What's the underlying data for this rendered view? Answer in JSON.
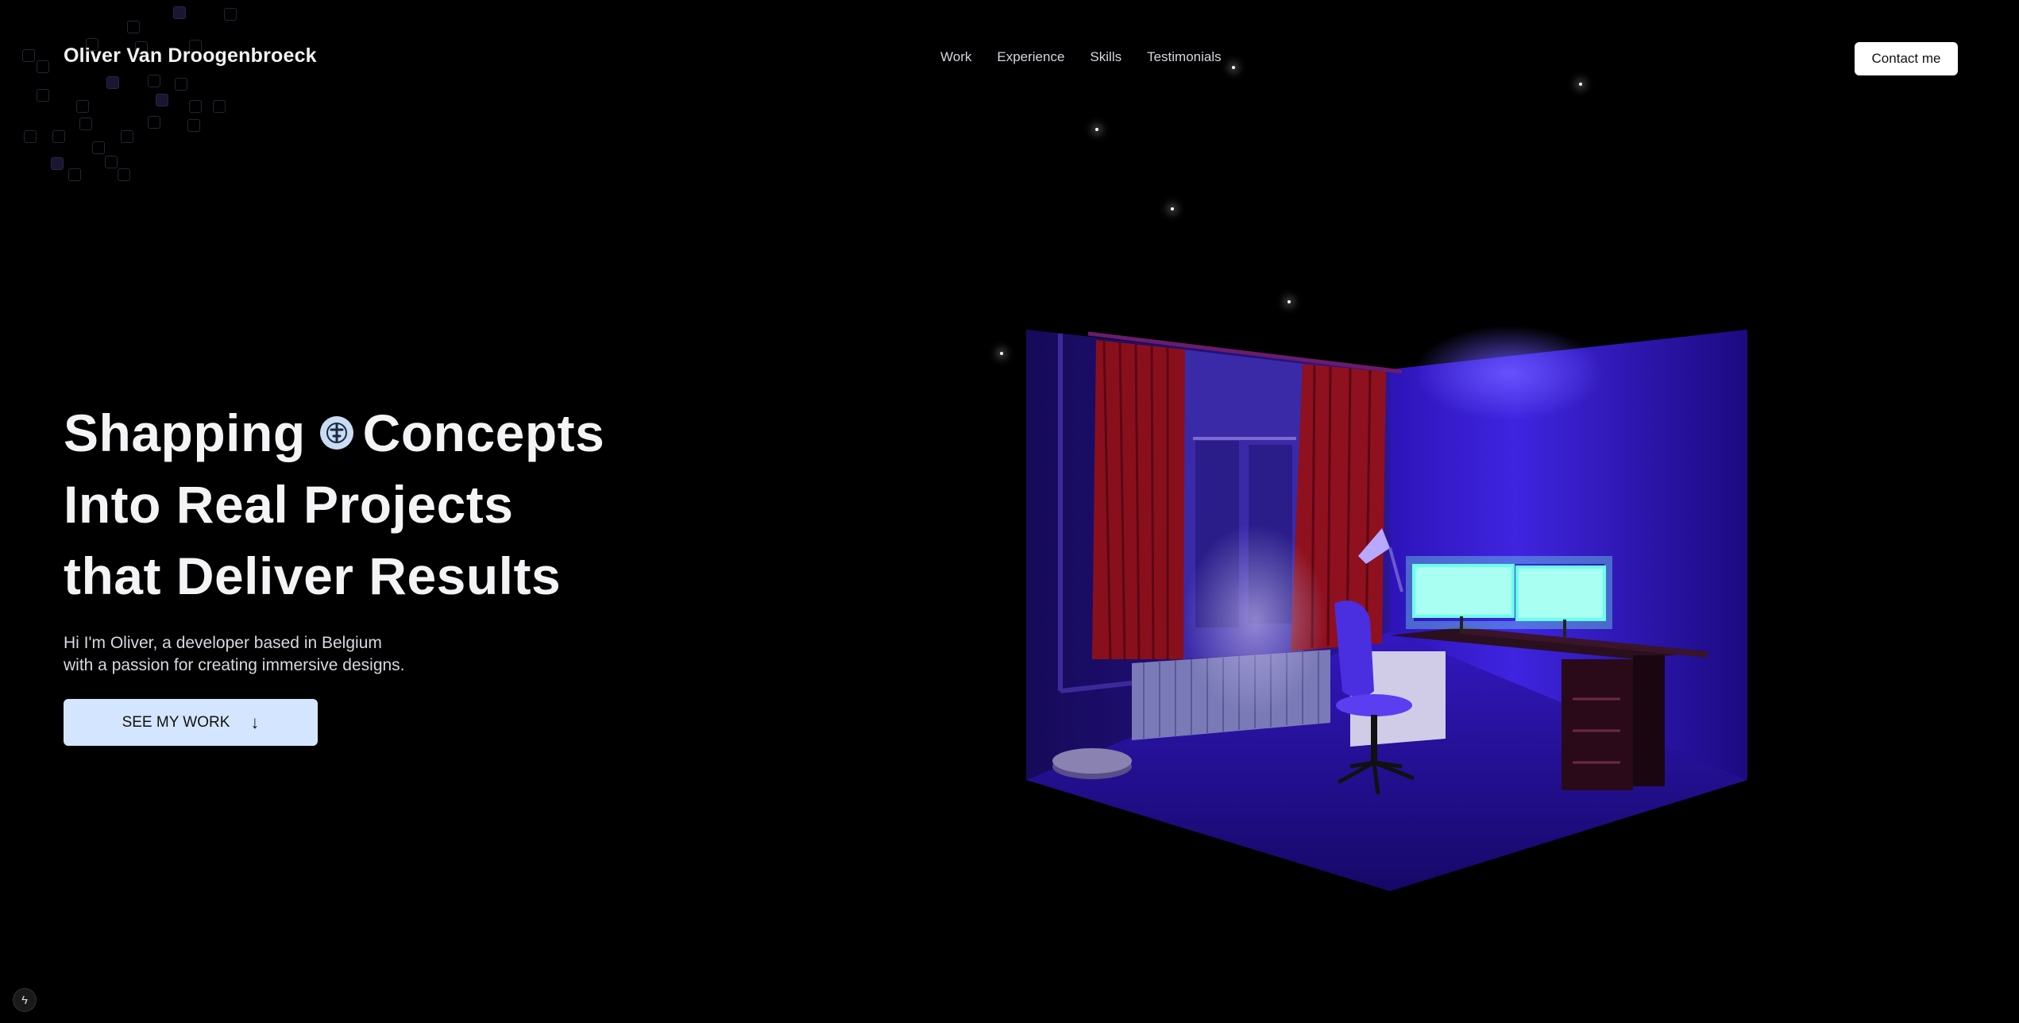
{
  "header": {
    "brand": "Oliver Van Droogenbroeck",
    "nav": [
      {
        "label": "Work"
      },
      {
        "label": "Experience"
      },
      {
        "label": "Skills"
      },
      {
        "label": "Testimonials"
      }
    ],
    "contact_label": "Contact me"
  },
  "hero": {
    "title_part1": "Shapping",
    "title_part2": "Concepts",
    "title_line2": "Into Real Projects",
    "title_line3": "that Deliver Results",
    "title_icon": "ideas-icon",
    "intro_line1": "Hi I'm Oliver, a developer based in Belgium",
    "intro_line2": "with a passion for creating immersive designs.",
    "cta_label": "SEE MY WORK",
    "cta_icon": "arrow-down-icon"
  },
  "scene": {
    "description_icon": "3d-room-scene",
    "colors": {
      "wall_light": "#3a1fd0",
      "wall_dark": "#1a0a7a",
      "curtain": "#8a0f1c",
      "monitor": "#a8fff2"
    }
  },
  "footer_icon": "bolt-icon"
}
